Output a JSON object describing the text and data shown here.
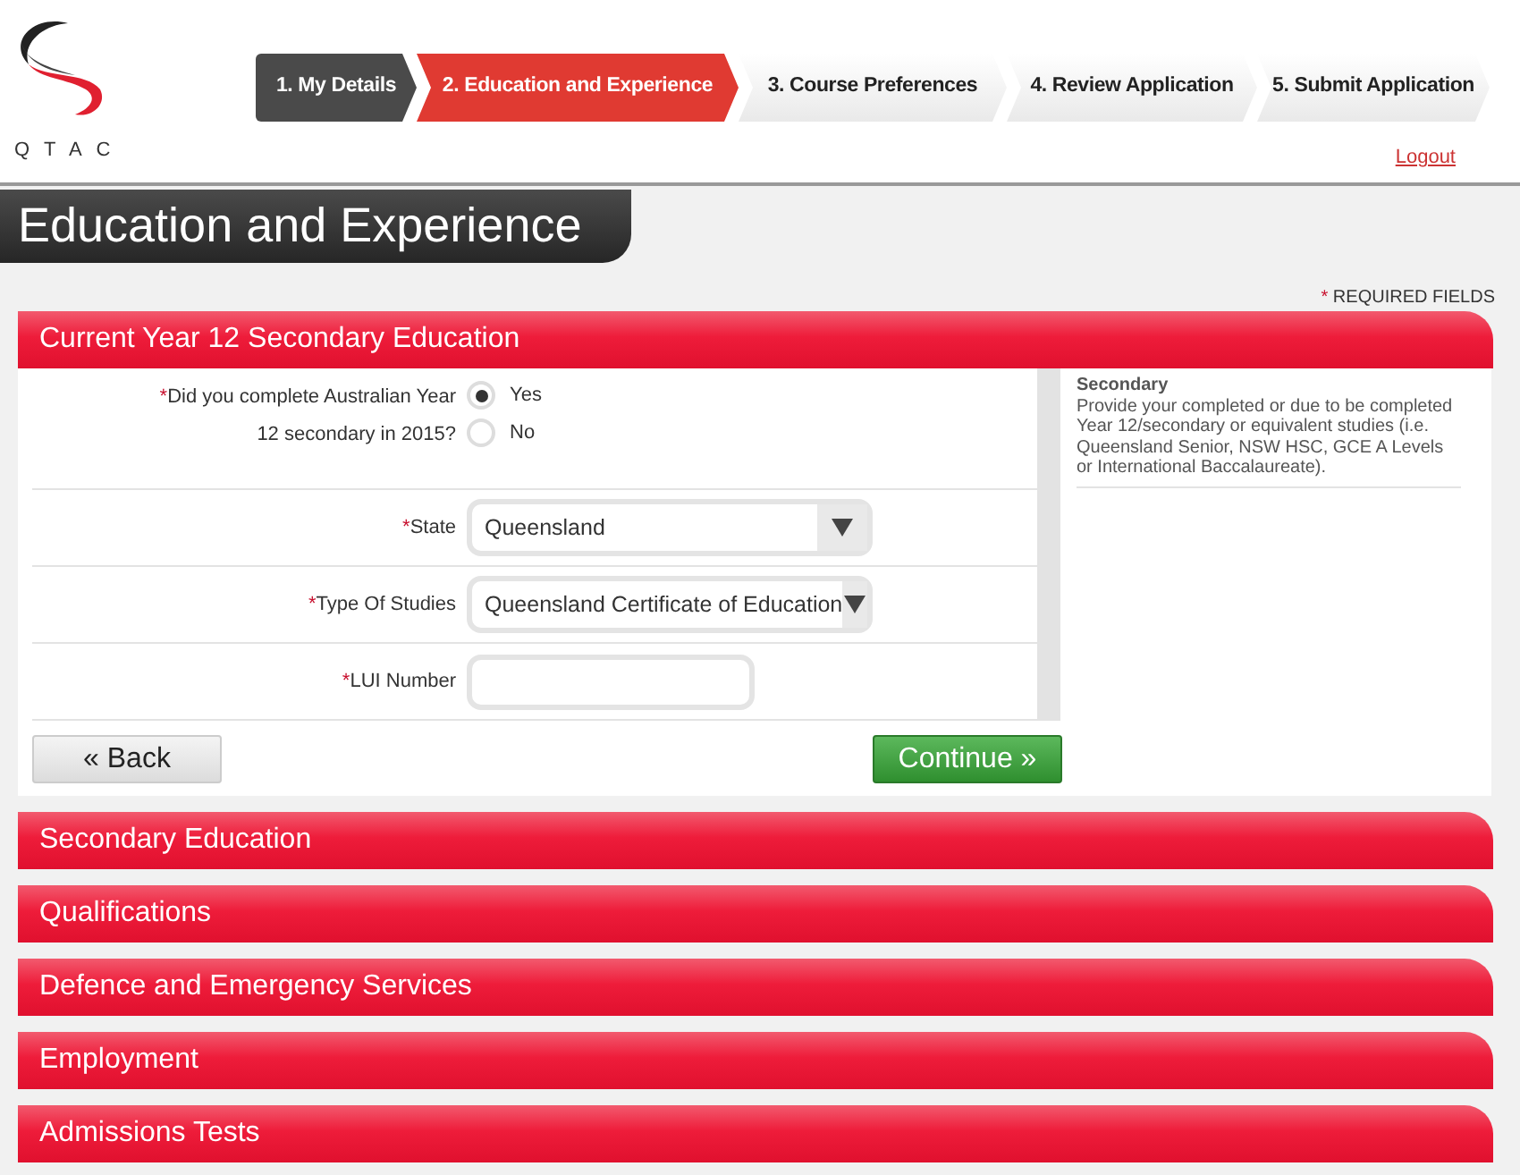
{
  "brand": {
    "name": "QTAC"
  },
  "steps": [
    {
      "label": "1. My Details",
      "completed": true,
      "selected": false
    },
    {
      "label": "2. Education and Experience",
      "completed": false,
      "selected": true
    },
    {
      "label": "3. Course Preferences",
      "completed": false,
      "selected": false
    },
    {
      "label": "4. Review Application",
      "completed": false,
      "selected": false
    },
    {
      "label": "5. Submit Application",
      "completed": false,
      "selected": false
    }
  ],
  "logout": "Logout",
  "page_title": "Education and Experience",
  "required_note": {
    "mark": "*",
    "text": "REQUIRED FIELDS"
  },
  "sections": [
    {
      "title": "Current Year 12 Secondary Education",
      "fields": [
        {
          "kind": "radio",
          "mark": "*",
          "label": "Did you complete Australian Year 12 secondary in 2015?",
          "options": [
            {
              "label": "Yes",
              "selected": true
            },
            {
              "label": "No",
              "selected": false
            }
          ]
        },
        {
          "kind": "select",
          "mark": "*",
          "label": "State",
          "value": "Queensland"
        },
        {
          "kind": "select",
          "mark": "*",
          "label": "Type Of Studies",
          "value": "Queensland Certificate of Education"
        },
        {
          "kind": "text",
          "mark": "*",
          "label": "LUI Number"
        }
      ],
      "help": {
        "title": "Secondary",
        "text": "Provide your completed or due to be completed Year 12/secondary or equivalent studies (i.e. Queensland Senior, NSW HSC, GCE A Levels or International Baccalaureate)."
      },
      "back": "« Back",
      "continue": "Continue »"
    },
    {
      "title": "Secondary Education"
    },
    {
      "title": "Qualifications"
    },
    {
      "title": "Defence and Emergency Services"
    },
    {
      "title": "Employment"
    },
    {
      "title": "Admissions Tests"
    }
  ]
}
